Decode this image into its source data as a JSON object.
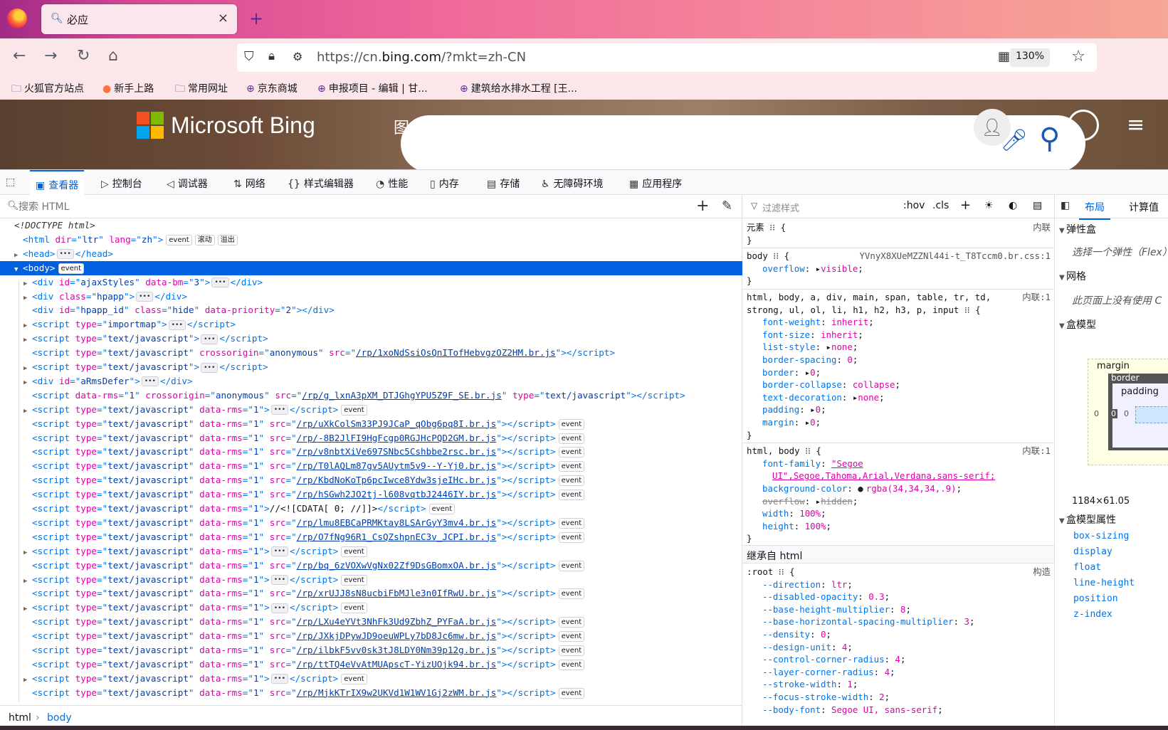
{
  "browser": {
    "tab_title": "必应",
    "url_prefix": "https://cn.",
    "url_domain": "bing.com",
    "url_path": "/?mkt=zh-CN",
    "zoom": "130%",
    "bookmarks": [
      "火狐官方站点",
      "新手上路",
      "常用网址",
      "京东商城",
      "申报项目 - 编辑 | 甘...",
      "建筑给水排水工程 [王..."
    ]
  },
  "page": {
    "brand": "Microsoft Bing",
    "partial_text": "图"
  },
  "devtools": {
    "tabs": [
      "查看器",
      "控制台",
      "调试器",
      "网络",
      "样式编辑器",
      "性能",
      "内存",
      "存储",
      "无障碍环境",
      "应用程序"
    ],
    "search_placeholder": "搜索 HTML",
    "filter_placeholder": "过滤样式",
    "hov": ":hov",
    "cls": ".cls",
    "breadcrumbs": [
      "html",
      "body"
    ],
    "layout_tabs": [
      "布局",
      "计算值"
    ],
    "layout": {
      "flex_title": "弹性盒",
      "flex_hint": "选择一个弹性（Flex）",
      "grid_title": "网格",
      "grid_hint": "此页面上没有使用 C",
      "boxmodel_title": "盒模型",
      "margin_label": "margin",
      "border_label": "border",
      "padding_label": "padding",
      "zero": "0",
      "dims": "1184×61.05",
      "props_title": "盒模型属性",
      "props": [
        "box-sizing",
        "display",
        "float",
        "line-height",
        "position",
        "z-index"
      ]
    }
  },
  "dom_tree": [
    {
      "t": "<!DOCTYPE html>",
      "kind": "doctype"
    },
    {
      "t": "html",
      "attrs": [
        [
          "dir",
          "ltr"
        ],
        [
          "lang",
          "zh"
        ]
      ],
      "badges": [
        "event",
        "滚动",
        "溢出"
      ]
    },
    {
      "t": "head",
      "collapsed": true,
      "close": true
    },
    {
      "t": "body",
      "selected": true,
      "badges": [
        "event"
      ],
      "open": true
    },
    {
      "t": "div",
      "attrs": [
        [
          "id",
          "ajaxStyles"
        ],
        [
          "data-bm",
          "3"
        ]
      ],
      "collapsed": true,
      "close": true,
      "d": 1
    },
    {
      "t": "div",
      "attrs": [
        [
          "class",
          "hpapp"
        ]
      ],
      "collapsed": true,
      "close": true,
      "d": 1
    },
    {
      "t": "div",
      "attrs": [
        [
          "id",
          "hpapp_id"
        ],
        [
          "class",
          "hide"
        ],
        [
          "data-priority",
          "2"
        ]
      ],
      "empty": true,
      "d": 1
    },
    {
      "t": "script",
      "attrs": [
        [
          "type",
          "importmap"
        ]
      ],
      "collapsed": true,
      "close": true,
      "d": 1
    },
    {
      "t": "script",
      "attrs": [
        [
          "type",
          "text/javascript"
        ]
      ],
      "collapsed": true,
      "close": true,
      "d": 1
    },
    {
      "t": "script",
      "attrs": [
        [
          "type",
          "text/javascript"
        ],
        [
          "crossorigin",
          "anonymous"
        ],
        [
          "src",
          "/rp/1xoNdSsiOsQnITofHebvgzOZ2HM.br.js"
        ]
      ],
      "empty": true,
      "d": 1
    },
    {
      "t": "script",
      "attrs": [
        [
          "type",
          "text/javascript"
        ]
      ],
      "collapsed": true,
      "close": true,
      "d": 1
    },
    {
      "t": "div",
      "attrs": [
        [
          "id",
          "aRmsDefer"
        ]
      ],
      "collapsed": true,
      "close": true,
      "d": 1
    },
    {
      "t": "script",
      "attrs": [
        [
          "data-rms",
          "1"
        ],
        [
          "crossorigin",
          "anonymous"
        ],
        [
          "src",
          "/rp/g_lxnA3pXM_DTJGhgYPU5Z9F_SE.br.js"
        ],
        [
          "type",
          "text/javascript"
        ]
      ],
      "empty": true,
      "d": 1
    },
    {
      "t": "script",
      "attrs": [
        [
          "type",
          "text/javascript"
        ],
        [
          "data-rms",
          "1"
        ]
      ],
      "collapsed": true,
      "close": true,
      "badges": [
        "event"
      ],
      "d": 1
    },
    {
      "t": "script",
      "attrs": [
        [
          "type",
          "text/javascript"
        ],
        [
          "data-rms",
          "1"
        ],
        [
          "src",
          "/rp/uXkColSm33PJ9JCaP_qObg6pq8I.br.js"
        ]
      ],
      "empty": true,
      "badges": [
        "event"
      ],
      "d": 1
    },
    {
      "t": "script",
      "attrs": [
        [
          "type",
          "text/javascript"
        ],
        [
          "data-rms",
          "1"
        ],
        [
          "src",
          "/rp/-8B2JlFI9HgFcgp0RGJHcPQD2GM.br.js"
        ]
      ],
      "empty": true,
      "badges": [
        "event"
      ],
      "d": 1
    },
    {
      "t": "script",
      "attrs": [
        [
          "type",
          "text/javascript"
        ],
        [
          "data-rms",
          "1"
        ],
        [
          "src",
          "/rp/v8nbtXiVe697SNbc5Cshbbe2rsc.br.js"
        ]
      ],
      "empty": true,
      "badges": [
        "event"
      ],
      "d": 1
    },
    {
      "t": "script",
      "attrs": [
        [
          "type",
          "text/javascript"
        ],
        [
          "data-rms",
          "1"
        ],
        [
          "src",
          "/rp/T0lAQLm87gv5AUytm5v9--Y-Yj0.br.js"
        ]
      ],
      "empty": true,
      "badges": [
        "event"
      ],
      "d": 1
    },
    {
      "t": "script",
      "attrs": [
        [
          "type",
          "text/javascript"
        ],
        [
          "data-rms",
          "1"
        ],
        [
          "src",
          "/rp/KbdNoKoTp6pcIwce8Ydw3sjeIHc.br.js"
        ]
      ],
      "empty": true,
      "badges": [
        "event"
      ],
      "d": 1
    },
    {
      "t": "script",
      "attrs": [
        [
          "type",
          "text/javascript"
        ],
        [
          "data-rms",
          "1"
        ],
        [
          "src",
          "/rp/hSGwh2JO2tj-l608vqtbJ2446IY.br.js"
        ]
      ],
      "empty": true,
      "badges": [
        "event"
      ],
      "d": 1
    },
    {
      "t": "script",
      "attrs": [
        [
          "type",
          "text/javascript"
        ],
        [
          "data-rms",
          "1"
        ]
      ],
      "inner": "//<![CDATA[ 0; //]]>",
      "empty": true,
      "badges": [
        "event"
      ],
      "d": 1
    },
    {
      "t": "script",
      "attrs": [
        [
          "type",
          "text/javascript"
        ],
        [
          "data-rms",
          "1"
        ],
        [
          "src",
          "/rp/lmu8EBCaPRMKtay8LSArGyY3mv4.br.js"
        ]
      ],
      "empty": true,
      "badges": [
        "event"
      ],
      "d": 1
    },
    {
      "t": "script",
      "attrs": [
        [
          "type",
          "text/javascript"
        ],
        [
          "data-rms",
          "1"
        ],
        [
          "src",
          "/rp/O7fNg96R1_CsQZshpnEC3v_JCPI.br.js"
        ]
      ],
      "empty": true,
      "badges": [
        "event"
      ],
      "d": 1
    },
    {
      "t": "script",
      "attrs": [
        [
          "type",
          "text/javascript"
        ],
        [
          "data-rms",
          "1"
        ]
      ],
      "collapsed": true,
      "close": true,
      "badges": [
        "event"
      ],
      "d": 1
    },
    {
      "t": "script",
      "attrs": [
        [
          "type",
          "text/javascript"
        ],
        [
          "data-rms",
          "1"
        ],
        [
          "src",
          "/rp/bq_6zVOXwVgNx02Zf9DsGBomxOA.br.js"
        ]
      ],
      "empty": true,
      "badges": [
        "event"
      ],
      "d": 1
    },
    {
      "t": "script",
      "attrs": [
        [
          "type",
          "text/javascript"
        ],
        [
          "data-rms",
          "1"
        ]
      ],
      "collapsed": true,
      "close": true,
      "badges": [
        "event"
      ],
      "d": 1
    },
    {
      "t": "script",
      "attrs": [
        [
          "type",
          "text/javascript"
        ],
        [
          "data-rms",
          "1"
        ],
        [
          "src",
          "/rp/xrUJJ8sN8ucbiFbMJle3n0IfRwU.br.js"
        ]
      ],
      "empty": true,
      "badges": [
        "event"
      ],
      "d": 1
    },
    {
      "t": "script",
      "attrs": [
        [
          "type",
          "text/javascript"
        ],
        [
          "data-rms",
          "1"
        ]
      ],
      "collapsed": true,
      "close": true,
      "badges": [
        "event"
      ],
      "d": 1
    },
    {
      "t": "script",
      "attrs": [
        [
          "type",
          "text/javascript"
        ],
        [
          "data-rms",
          "1"
        ],
        [
          "src",
          "/rp/LXu4eYVt3NhFk3Ud9ZbhZ_PYFaA.br.js"
        ]
      ],
      "empty": true,
      "badges": [
        "event"
      ],
      "d": 1
    },
    {
      "t": "script",
      "attrs": [
        [
          "type",
          "text/javascript"
        ],
        [
          "data-rms",
          "1"
        ],
        [
          "src",
          "/rp/JXkjDPywJD9oeuWPLy7bD8Jc6mw.br.js"
        ]
      ],
      "empty": true,
      "badges": [
        "event"
      ],
      "d": 1
    },
    {
      "t": "script",
      "attrs": [
        [
          "type",
          "text/javascript"
        ],
        [
          "data-rms",
          "1"
        ],
        [
          "src",
          "/rp/ilbkF5vv0sk3tJ8LDY0Nm39p12g.br.js"
        ]
      ],
      "empty": true,
      "badges": [
        "event"
      ],
      "d": 1
    },
    {
      "t": "script",
      "attrs": [
        [
          "type",
          "text/javascript"
        ],
        [
          "data-rms",
          "1"
        ],
        [
          "src",
          "/rp/ttTQ4eVvAtMUApscT-YizUOjk94.br.js"
        ]
      ],
      "empty": true,
      "badges": [
        "event"
      ],
      "d": 1
    },
    {
      "t": "script",
      "attrs": [
        [
          "type",
          "text/javascript"
        ],
        [
          "data-rms",
          "1"
        ]
      ],
      "collapsed": true,
      "close": true,
      "badges": [
        "event"
      ],
      "d": 1
    },
    {
      "t": "script",
      "attrs": [
        [
          "type",
          "text/javascript"
        ],
        [
          "data-rms",
          "1"
        ],
        [
          "src",
          "/rp/MjkKTrIX9w2UKVd1W1WV1Gj2zWM.br.js"
        ]
      ],
      "empty": true,
      "badges": [
        "event"
      ],
      "d": 1
    }
  ],
  "rules": [
    {
      "sel": "元素",
      "src": "内联",
      "open": true
    },
    {
      "close": true
    },
    {
      "sep": true
    },
    {
      "sel": "body",
      "src": "YVnyX8XUeMZZNl44i-t_T8Tccm0.br.css:1",
      "open": true
    },
    {
      "p": "overflow",
      "v": "visible",
      "tri": true
    },
    {
      "close": true
    },
    {
      "sep": true
    },
    {
      "sel": "html, body, a, div, main, span, table, tr, td,",
      "src": "内联:1"
    },
    {
      "sel": "strong, ul, ol, li, h1, h2, h3, p, input",
      "open": true
    },
    {
      "p": "font-weight",
      "v": "inherit"
    },
    {
      "p": "font-size",
      "v": "inherit"
    },
    {
      "p": "list-style",
      "v": "none",
      "tri": true
    },
    {
      "p": "border-spacing",
      "v": "0"
    },
    {
      "p": "border",
      "v": "0",
      "tri": true
    },
    {
      "p": "border-collapse",
      "v": "collapse"
    },
    {
      "p": "text-decoration",
      "v": "none",
      "tri": true
    },
    {
      "p": "padding",
      "v": "0",
      "tri": true
    },
    {
      "p": "margin",
      "v": "0",
      "tri": true
    },
    {
      "close": true
    },
    {
      "sep": true
    },
    {
      "sel": "html, body",
      "src": "内联:1",
      "open": true
    },
    {
      "p": "font-family",
      "v": "\"Segoe"
    },
    {
      "cont": "UI\",Segoe,Tahoma,Arial,Verdana,sans-serif;"
    },
    {
      "p": "background-color",
      "v": "rgba(34,34,34,.9)",
      "swatch": "#222222"
    },
    {
      "p": "overflow",
      "v": "hidden",
      "tri": true,
      "strike": true
    },
    {
      "p": "width",
      "v": "100%"
    },
    {
      "p": "height",
      "v": "100%"
    },
    {
      "close": true
    },
    {
      "inherit": "继承自 html"
    },
    {
      "sel": ":root",
      "src": "构造",
      "open": true
    },
    {
      "p": "--direction",
      "v": "ltr"
    },
    {
      "p": "--disabled-opacity",
      "v": "0.3"
    },
    {
      "p": "--base-height-multiplier",
      "v": "8"
    },
    {
      "p": "--base-horizontal-spacing-multiplier",
      "v": "3"
    },
    {
      "p": "--density",
      "v": "0"
    },
    {
      "p": "--design-unit",
      "v": "4"
    },
    {
      "p": "--control-corner-radius",
      "v": "4"
    },
    {
      "p": "--layer-corner-radius",
      "v": "4"
    },
    {
      "p": "--stroke-width",
      "v": "1"
    },
    {
      "p": "--focus-stroke-width",
      "v": "2"
    },
    {
      "p": "--body-font",
      "v": "Segoe UI, sans-serif"
    }
  ]
}
